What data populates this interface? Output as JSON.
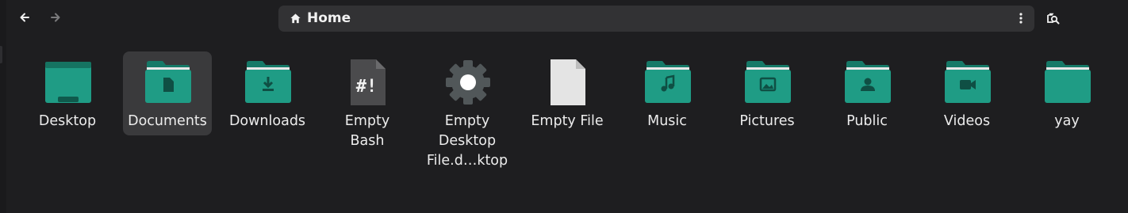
{
  "toolbar": {
    "back_icon": "arrow-left-icon",
    "forward_icon": "arrow-right-icon",
    "location": "Home",
    "location_icon": "home-icon",
    "menu_icon": "vertical-dots-icon",
    "search_icon": "search-folder-icon"
  },
  "colors": {
    "background": "#1e1e20",
    "folder": "#1f9c85",
    "folder_dark": "#167a68",
    "selection": "#3a3a3c",
    "pathbar": "#323234"
  },
  "files": [
    {
      "label": "Desktop",
      "icon": "desktop-folder-icon"
    },
    {
      "label": "Documents",
      "icon": "documents-folder-icon",
      "selected": true
    },
    {
      "label": "Downloads",
      "icon": "downloads-folder-icon"
    },
    {
      "label": "Empty\nBash",
      "icon": "bash-script-icon"
    },
    {
      "label": "Empty\nDesktop\nFile.d…ktop",
      "icon": "gear-icon"
    },
    {
      "label": "Empty File",
      "icon": "blank-file-icon"
    },
    {
      "label": "Music",
      "icon": "music-folder-icon"
    },
    {
      "label": "Pictures",
      "icon": "pictures-folder-icon"
    },
    {
      "label": "Public",
      "icon": "public-folder-icon"
    },
    {
      "label": "Videos",
      "icon": "videos-folder-icon"
    },
    {
      "label": "yay",
      "icon": "folder-icon"
    }
  ]
}
